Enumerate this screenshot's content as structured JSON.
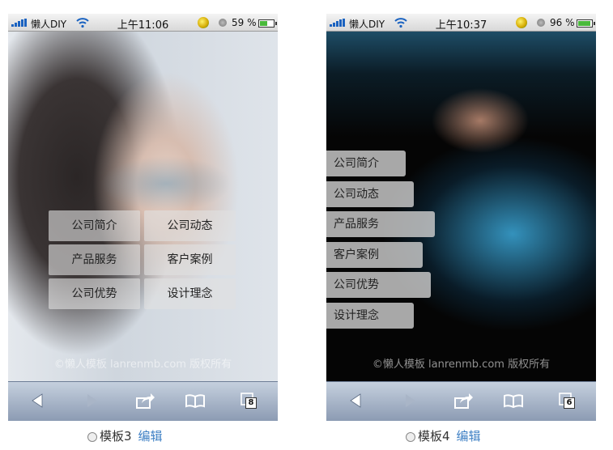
{
  "templates": [
    {
      "statusbar": {
        "carrier": "懒人DIY",
        "time": "上午11:06",
        "battery_text": "59 %",
        "battery_level": 0.59
      },
      "menu": [
        "公司简介",
        "公司动态",
        "产品服务",
        "客户案例",
        "公司优势",
        "设计理念"
      ],
      "watermark": "©懒人模板 lanrenmb.com 版权所有",
      "toolbar": {
        "page_count": "8"
      },
      "caption": {
        "label": "模板3",
        "edit": "编辑"
      }
    },
    {
      "statusbar": {
        "carrier": "懒人DIY",
        "time": "上午10:37",
        "battery_text": "96 %",
        "battery_level": 0.96
      },
      "menu": [
        "公司简介",
        "公司动态",
        "产品服务",
        "客户案例",
        "公司优势",
        "设计理念"
      ],
      "watermark": "©懒人模板 lanrenmb.com 版权所有",
      "toolbar": {
        "page_count": "6"
      },
      "caption": {
        "label": "模板4",
        "edit": "编辑"
      }
    }
  ],
  "colors": {
    "accent_link": "#3d7fc4",
    "battery_green": "#49b93a",
    "signal_blue": "#1a62c0"
  },
  "icons": [
    "signal-icon",
    "wifi-icon",
    "app-status-icon",
    "lock-icon",
    "battery-icon",
    "back-icon",
    "forward-icon",
    "share-icon",
    "bookmarks-icon",
    "pages-icon"
  ]
}
